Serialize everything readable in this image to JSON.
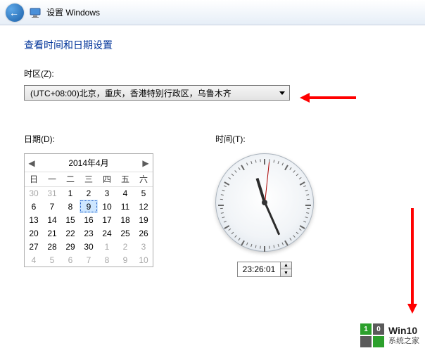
{
  "header": {
    "title": "设置 Windows"
  },
  "page": {
    "heading": "查看时间和日期设置"
  },
  "timezone": {
    "label": "时区(Z):",
    "selected": "(UTC+08:00)北京，重庆，香港特别行政区，乌鲁木齐"
  },
  "date": {
    "label": "日期(D):",
    "month_title": "2014年4月",
    "weekdays": [
      "日",
      "一",
      "二",
      "三",
      "四",
      "五",
      "六"
    ],
    "selected_day": 9,
    "weeks": [
      [
        {
          "d": 30,
          "o": true
        },
        {
          "d": 31,
          "o": true
        },
        {
          "d": 1
        },
        {
          "d": 2
        },
        {
          "d": 3
        },
        {
          "d": 4
        },
        {
          "d": 5
        }
      ],
      [
        {
          "d": 6
        },
        {
          "d": 7
        },
        {
          "d": 8
        },
        {
          "d": 9,
          "sel": true
        },
        {
          "d": 10
        },
        {
          "d": 11
        },
        {
          "d": 12
        }
      ],
      [
        {
          "d": 13
        },
        {
          "d": 14
        },
        {
          "d": 15
        },
        {
          "d": 16
        },
        {
          "d": 17
        },
        {
          "d": 18
        },
        {
          "d": 19
        }
      ],
      [
        {
          "d": 20
        },
        {
          "d": 21
        },
        {
          "d": 22
        },
        {
          "d": 23
        },
        {
          "d": 24
        },
        {
          "d": 25
        },
        {
          "d": 26
        }
      ],
      [
        {
          "d": 27
        },
        {
          "d": 28
        },
        {
          "d": 29
        },
        {
          "d": 30
        },
        {
          "d": 1,
          "o": true
        },
        {
          "d": 2,
          "o": true
        },
        {
          "d": 3,
          "o": true
        }
      ],
      [
        {
          "d": 4,
          "o": true
        },
        {
          "d": 5,
          "o": true
        },
        {
          "d": 6,
          "o": true
        },
        {
          "d": 7,
          "o": true
        },
        {
          "d": 8,
          "o": true
        },
        {
          "d": 9,
          "o": true
        },
        {
          "d": 10,
          "o": true
        }
      ]
    ]
  },
  "time": {
    "label": "时间(T):",
    "value": "23:26:01",
    "hours": 23,
    "minutes": 26,
    "seconds": 1
  },
  "logo": {
    "line1": "Win10",
    "line2": "系统之家"
  }
}
